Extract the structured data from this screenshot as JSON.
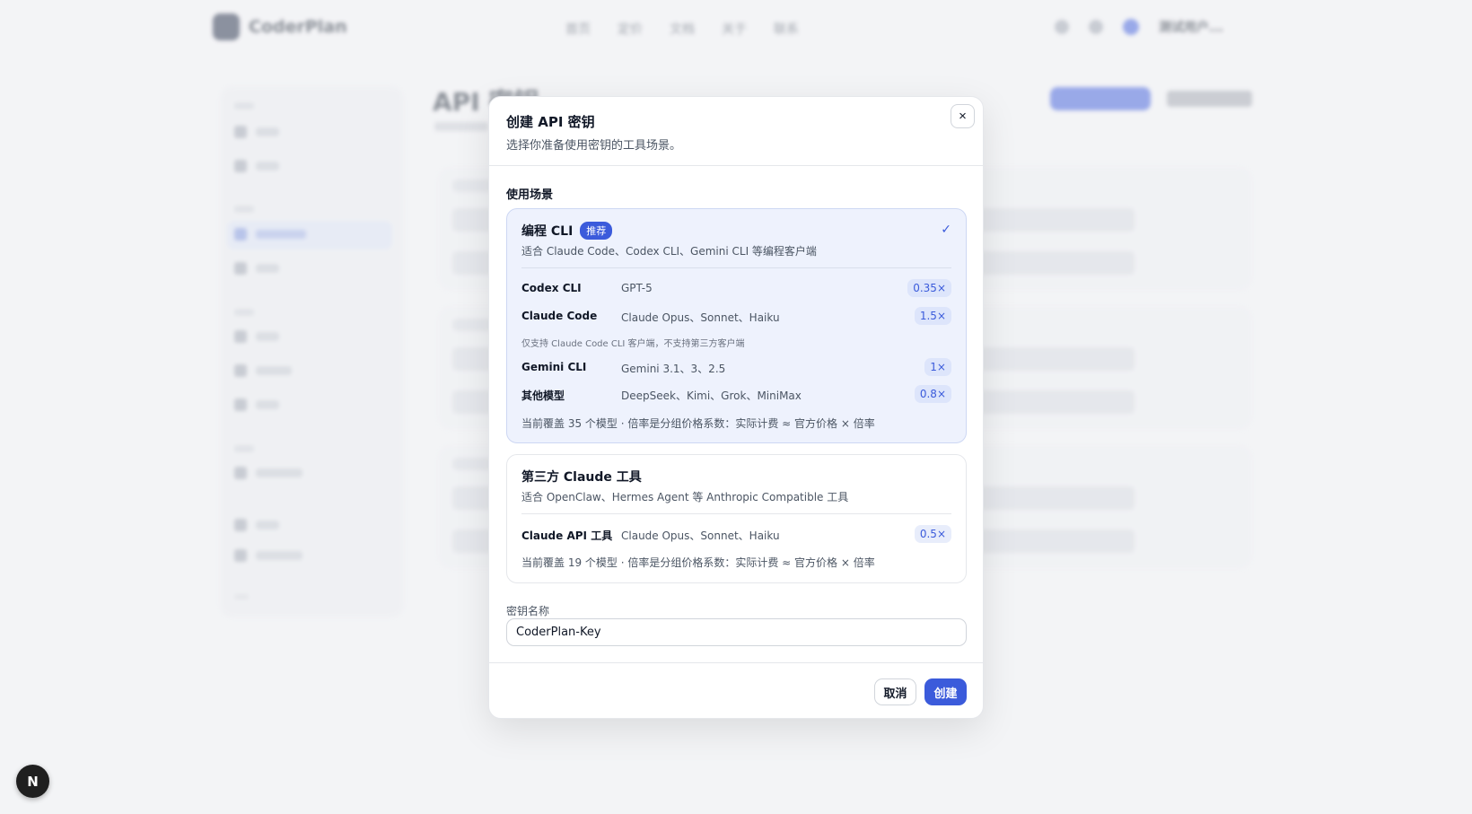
{
  "background": {
    "app_name": "CoderPlan",
    "nav": [
      "首页",
      "定价",
      "文档",
      "关于",
      "联系"
    ],
    "user_name": "测试用户...",
    "page_title": "API 密钥"
  },
  "modal": {
    "title": "创建 API 密钥",
    "description": "选择你准备使用密钥的工具场景。",
    "close_icon": "×",
    "section_label": "使用场景",
    "options": [
      {
        "title": "编程 CLI",
        "badge": "推荐",
        "selected": true,
        "check_icon": "✓",
        "description": "适合 Claude Code、Codex CLI、Gemini CLI 等编程客户端",
        "rows": [
          {
            "tool": "Codex CLI",
            "models": "GPT-5",
            "rate": "0.35×"
          },
          {
            "tool": "Claude Code",
            "models": "Claude Opus、Sonnet、Haiku",
            "rate": "1.5×"
          },
          {
            "tool": "Gemini CLI",
            "models": "Gemini 3.1、3、2.5",
            "rate": "1×"
          },
          {
            "tool": "其他模型",
            "models": "DeepSeek、Kimi、Grok、MiniMax",
            "rate": "0.8×"
          }
        ],
        "note": "仅支持 Claude Code CLI 客户端，不支持第三方客户端",
        "footer": "当前覆盖 35 个模型 · 倍率是分组价格系数：实际计费 ≈ 官方价格 × 倍率"
      },
      {
        "title": "第三方 Claude 工具",
        "selected": false,
        "description": "适合 OpenClaw、Hermes Agent 等 Anthropic Compatible 工具",
        "rows": [
          {
            "tool": "Claude API 工具",
            "models": "Claude Opus、Sonnet、Haiku",
            "rate": "0.5×"
          }
        ],
        "footer": "当前覆盖 19 个模型 · 倍率是分组价格系数：实际计费 ≈ 官方价格 × 倍率"
      }
    ],
    "key_name_label": "密钥名称",
    "key_name_value": "CoderPlan-Key",
    "cancel_label": "取消",
    "create_label": "创建"
  },
  "fab_label": "N"
}
